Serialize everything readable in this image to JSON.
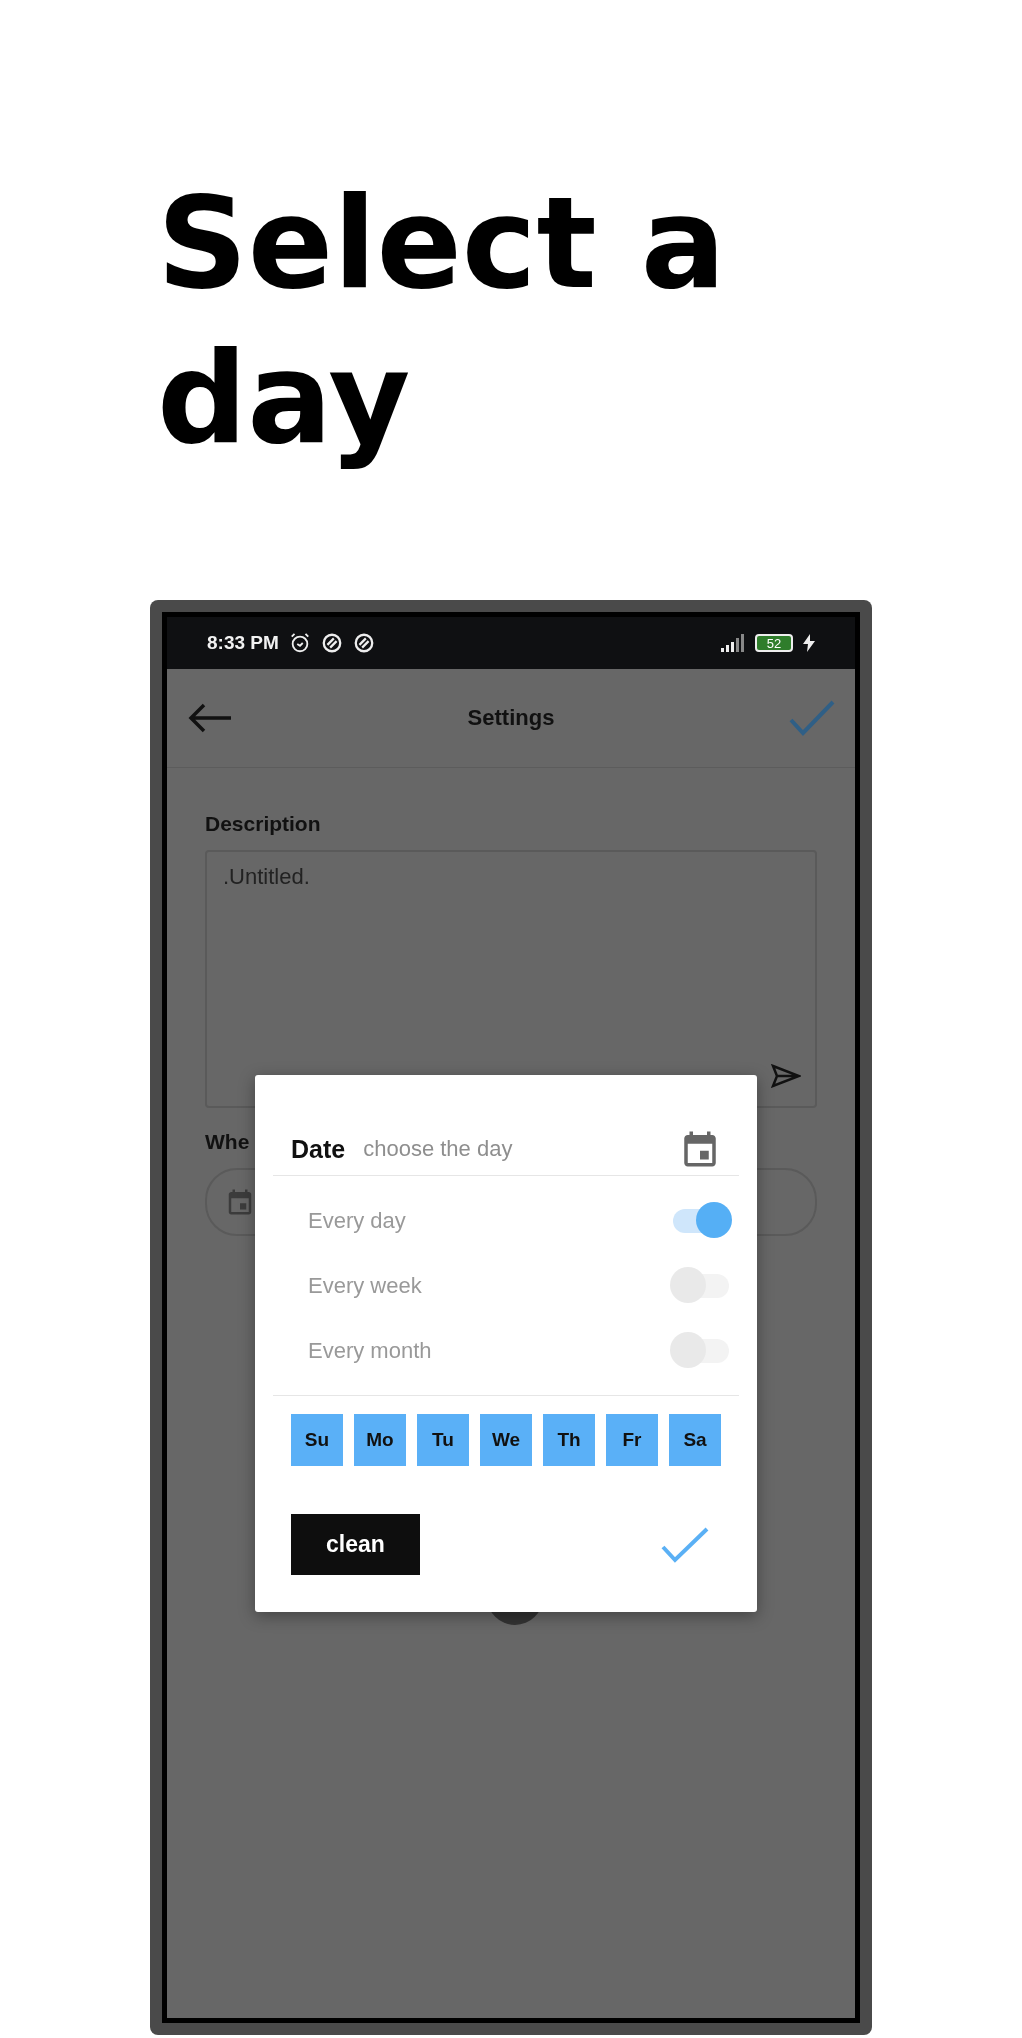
{
  "heading": "Select a day",
  "status_bar": {
    "time": "8:33 PM",
    "battery": "52"
  },
  "app_bar": {
    "title": "Settings"
  },
  "form": {
    "description_label": "Description",
    "description_value": ".Untitled.",
    "when_label": "Whe"
  },
  "dialog": {
    "title": "Date",
    "subtitle": "choose the day",
    "toggles": [
      {
        "label": "Every day",
        "on": true
      },
      {
        "label": "Every week",
        "on": false
      },
      {
        "label": "Every month",
        "on": false
      }
    ],
    "days": [
      {
        "label": "Su",
        "selected": true
      },
      {
        "label": "Mo",
        "selected": true
      },
      {
        "label": "Tu",
        "selected": true
      },
      {
        "label": "We",
        "selected": true
      },
      {
        "label": "Th",
        "selected": true
      },
      {
        "label": "Fr",
        "selected": true
      },
      {
        "label": "Sa",
        "selected": true
      }
    ],
    "clear_button": "clean"
  }
}
